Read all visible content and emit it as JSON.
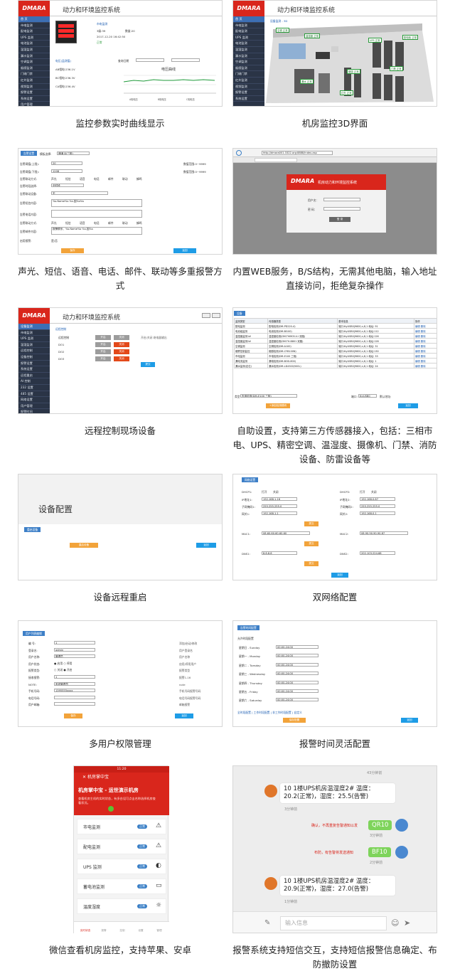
{
  "captions": [
    "监控参数实时曲线显示",
    "机房监控3D界面",
    "声光、短信、语音、电话、邮件、联动等多重报警方式",
    "内置WEB服务，B/S结构，无需其他电脑，输入地址直接访问，拒绝复杂操作",
    "远程控制现场设备",
    "自助设置，支持第三方传感器接入，包括：三相市电、UPS、精密空调、温湿度、摄像机、门禁、消防设备、防雷设备等",
    "设备远程重启",
    "双网络配置",
    "多用户权限管理",
    "报警时间灵活配置",
    "微信查看机房监控，支持苹果、安卓",
    "报警系统支持短信交互，支持短信报警信息确定、布防撤防设置"
  ],
  "brand": {
    "logo": "DMARA",
    "app_title": "动力和环境监控系统",
    "login_title": "机房动力和环境监控系统"
  },
  "s1": {
    "sidebar": [
      "首 页",
      "市电监测",
      "配电监测",
      "UPS 监测",
      "电池监测",
      "温湿监测",
      "漏水监测",
      "空调监测",
      "烟感监测",
      "门磁门禁",
      "红外监测",
      "视频监测",
      "报警设置",
      "系统设置",
      "用户管理",
      "退出系统"
    ],
    "info": [
      "市电监测",
      "3级:39",
      "数量:20",
      "2017-12-20 16:42:50",
      "正常"
    ],
    "readings": [
      "电压(监测值)",
      "AB相电:236.1V",
      "BC相电:236.3V",
      "CA相电:236.4V"
    ],
    "chart_title": "电压曲线",
    "legend": [
      "A相电压",
      "B相电压",
      "C相电压"
    ],
    "tool_label": "查询日期"
  },
  "s2": {
    "sidebar": [
      "首 页",
      "市电监测",
      "配电监测",
      "UPS 监测",
      "电池监测",
      "温湿监测",
      "漏水监测",
      "空调监测",
      "烟感监测",
      "门磁门禁",
      "红外监测",
      "视频监测",
      "报警设置",
      "系统设置"
    ],
    "header": "设备监测 - 3D",
    "tags": [
      "空调 正常",
      "温湿度 正常",
      "UPS 正常",
      "配电柜 正常",
      "漏水 正常",
      "烟感 正常",
      "门禁 正常",
      "红外 正常"
    ]
  },
  "s3": {
    "tab": "告警设置",
    "select_label": "模板选择:",
    "select_value": "通道 B(三相)",
    "rows": [
      {
        "label": "告警阈值(上限):",
        "value": "20",
        "hint": "数值范围:0~9999"
      },
      {
        "label": "告警阈值(下限):",
        "value": "1208",
        "hint": "数值范围:0~9999"
      }
    ],
    "methods_label": "告警联动方式:",
    "methods": [
      "声光",
      "短信",
      "语音",
      "电话",
      "邮件",
      "联动",
      "蜂鸣"
    ],
    "fields": [
      "告警时段选择:",
      "告警联动设备:",
      "告警短信内容:",
      "告警电话内容:",
      "告警邮件内容:",
      "恢复短信内容:"
    ],
    "time_value": "全时段",
    "link_value": "无",
    "sms_content": "%s.Name%s %s.因%s%s",
    "mail_content": "报警联系，%s.Name%s %s.因%s",
    "enable_label": "启用报警:",
    "enable_value": "是/否",
    "save": "保存",
    "back": "返回"
  },
  "s4": {
    "url": "http://dmara001.3322.org:8888/index.asp",
    "user_label": "用户名：",
    "pass_label": "密 码：",
    "login_btn": "登 录"
  },
  "s5": {
    "sidebar": [
      "设备监测",
      "市电监测",
      "UPS 监测",
      "温湿监测",
      "远程控制",
      "设备控制",
      "报警设置",
      "系统设置",
      "远程重启",
      "AI 控制",
      "232 设置",
      "485 设置",
      "网络设置",
      "用户管理",
      "报警时间",
      "退出系统"
    ],
    "tab": "远程控制",
    "rows": [
      {
        "label": "远程控制",
        "a": "开启",
        "b": "关闭",
        "note": "开启/关闭 继电器输出"
      },
      {
        "label": "DO1",
        "a": "开启",
        "b": "关闭"
      },
      {
        "label": "DO2",
        "a": "开启",
        "b": "关闭"
      },
      {
        "label": "DO3",
        "a": "开启",
        "b": "关闭"
      }
    ],
    "submit": "提交"
  },
  "s6": {
    "tab": "设备",
    "headers": [
      "监测类型",
      "传感器类型",
      "基本信息",
      "操作"
    ],
    "rows": [
      [
        "配电监测",
        "配电检测(DM-PD220-4)",
        "端口:ttyUSB0|9600,n,8,1 地址: 91",
        "编辑 删除"
      ],
      [
        "电池组监测",
        "电池检测(DM-BI100)",
        "端口:ttyUSB0|9600,n,8,1 地址:112",
        "编辑 删除"
      ],
      [
        "温湿度监测1#",
        "温湿度检测(DM-THM05-V-I 双路)",
        "端口:ttyUSB0|9600,n,8,1 地址:126",
        "编辑 删除"
      ],
      [
        "温湿度监测2#",
        "温湿度检测(DM-TH-B801 双路)",
        "端口:ttyUSB0|9600,n,8,1 地址:128",
        "编辑 删除"
      ],
      [
        "空调监测",
        "空调检测(DM-A100)",
        "端口:ttyUSB0|9600,n,8,1 地址: 31",
        "编辑 删除"
      ],
      [
        "烟雾控制监控",
        "烟感检测(DM-CYB100N)",
        "端口:ttyUSB0|9600,n,8,1 地址:130",
        "编辑 删除"
      ],
      [
        "市电监测",
        "市电检测(DM-E100 三相)",
        "端口:ttyUSB0|9600,n,8,1 地址: 33",
        "编辑 删除"
      ],
      [
        "漏电流监测",
        "漏电检测(DM-BOD-800)",
        "端口:ttyUSB0|9600,n,8,1 地址:  1",
        "编辑 删除"
      ],
      [
        "漏水监测(定位)",
        "漏水检测(DM-LD4300/500L)",
        "端口:ttyUSB0|9600,n,8,1 地址: 24",
        "编辑 删除"
      ]
    ],
    "type_label": "类型:",
    "type_value": "市电检测(DM-E100 三相)",
    "port_label": "端口:",
    "port_value": "ttyUSB0",
    "addr_label": "默认地址:",
    "add_btn": "+添加检测模块",
    "back": "返回"
  },
  "s7": {
    "title": "设备配置",
    "tab": "重启设备",
    "restart": "重启设备",
    "back": "返回"
  },
  "s8": {
    "tab": "网络设置",
    "dhcp1": "DHCP1:",
    "dhcp2": "DHCP2:",
    "dhcp_opts": [
      "打开",
      "关闭"
    ],
    "left": [
      [
        "IP地址1:",
        "192.168.1.16"
      ],
      [
        "子网掩码1:",
        "255.255.255.0"
      ],
      [
        "网关1:",
        "192.168.1.1"
      ]
    ],
    "right": [
      [
        "IP地址2:",
        "192.168.0.87"
      ],
      [
        "子网掩码2:",
        "255.255.255.0"
      ],
      [
        "网关2:",
        "192.168.0.1"
      ]
    ],
    "mac1": [
      "MAC1:",
      "08.60.60.60.60.60"
    ],
    "mac2": [
      "MAC2:",
      "08.90.90.90.90.87"
    ],
    "dns1": [
      "DNS1:",
      "8.8.8.8"
    ],
    "dns2": [
      "DNS2:",
      "202.103.224.68"
    ],
    "submit": "提交",
    "back": "返回"
  },
  "s9": {
    "tab": "用户列表编辑",
    "rows": [
      [
        "编 号:",
        "1",
        "添加/启动/修改"
      ],
      [
        "登录名:",
        "admin",
        "用户登录名"
      ],
      [
        "用户名称:",
        "管理员",
        "用户名称"
      ],
      [
        "用户状态:",
        "● 启用 ○ 停用",
        "启用/停用用户"
      ],
      [
        "报警类型:",
        "○ 关闭 ● 开启",
        "报警类型"
      ],
      [
        "接收报警:",
        "1",
        "报警1-16"
      ],
      [
        "NOTE:",
        "系统管理员",
        "note"
      ],
      [
        "手机号码:",
        "1395555xxxx",
        "手机号码报警号码"
      ],
      [
        "电话号码:",
        "",
        "电话号码报警号码"
      ],
      [
        "用户邮箱:",
        "",
        "邮箱报警"
      ]
    ],
    "save": "保存",
    "back": "返回"
  },
  "s10": {
    "tab": "告警时间配置",
    "section": "允许时段配置",
    "days": [
      [
        "星期日 - Sunday",
        "00:00-24:00"
      ],
      [
        "星期一 - Monday",
        "00:00-24:00"
      ],
      [
        "星期二 - Tuesday",
        "00:00-24:00"
      ],
      [
        "星期三 - Wednesday",
        "00:00-24:00"
      ],
      [
        "星期四 - Thursday",
        "00:00-24:00"
      ],
      [
        "星期五 - Friday",
        "00:00-24:00"
      ],
      [
        "星期六 - Saturday",
        "00:00-24:00"
      ]
    ],
    "footer": "全时段配置 | 工作时段配置 | 非工作时段配置 | 自定义",
    "save": "保存配置",
    "back": "返回"
  },
  "s11": {
    "status": "11:20",
    "app_name": "机房掌中宝",
    "banner_title": "机房掌中宝 - 运世演示机房",
    "banner_text": "查看机房主机的实时状态，有多台设可点击名称选择机房查看状况。",
    "items": [
      {
        "label": "市电监测",
        "status": "正常"
      },
      {
        "label": "配电监测",
        "status": "正常"
      },
      {
        "label": "UPS 监测",
        "status": "正常"
      },
      {
        "label": "蓄电池监测",
        "status": "正常"
      },
      {
        "label": "温度湿度",
        "status": "正常"
      }
    ],
    "tabs": [
      "实时状态",
      "报警",
      "控制",
      "设置",
      "管理"
    ]
  },
  "s12": {
    "top_time": "43分钟前",
    "msg1": "10 1楼UPS机房温湿度2# 温度：20.2(正常)，湿度：25.5(告警)",
    "time1": "3分钟前",
    "note1": "确认，不再重复告警通知以发",
    "reply1": "QR10",
    "time2": "3分钟前",
    "note2": "布防，有告警将发送通知",
    "reply2": "BF10",
    "time3": "2分钟前",
    "msg2": "10 1楼UPS机房温湿度2# 温度：20.9(正常)，湿度：27.0(告警)",
    "time4": "1分钟前",
    "input_placeholder": "输入信息"
  }
}
